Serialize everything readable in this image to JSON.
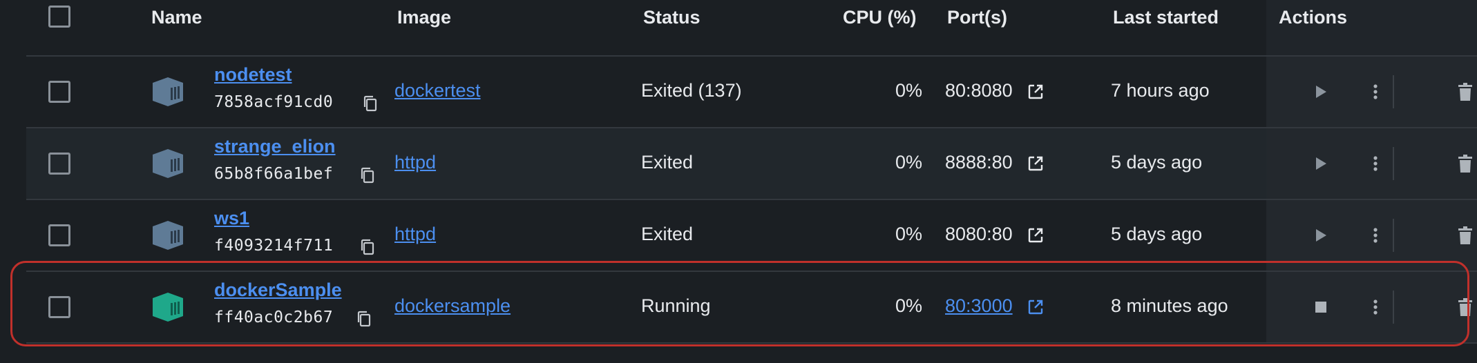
{
  "header": {
    "name": "Name",
    "image": "Image",
    "status": "Status",
    "cpu": "CPU (%)",
    "ports": "Port(s)",
    "last_started": "Last started",
    "actions": "Actions"
  },
  "rows": [
    {
      "name": "nodetest",
      "id": "7858acf91cd0",
      "image": "dockertest",
      "status": "Exited (137)",
      "cpu": "0%",
      "port": "80:8080",
      "last_started": "7 hours ago",
      "running": false
    },
    {
      "name": "strange_elion",
      "id": "65b8f66a1bef",
      "image": "httpd",
      "status": "Exited",
      "cpu": "0%",
      "port": "8888:80",
      "last_started": "5 days ago",
      "running": false
    },
    {
      "name": "ws1",
      "id": "f4093214f711",
      "image": "httpd",
      "status": "Exited",
      "cpu": "0%",
      "port": "8080:80",
      "last_started": "5 days ago",
      "running": false
    },
    {
      "name": "dockerSample",
      "id": "ff40ac0c2b67",
      "image": "dockersample",
      "status": "Running",
      "cpu": "0%",
      "port": "80:3000",
      "last_started": "8 minutes ago",
      "running": true
    }
  ],
  "colors": {
    "background": "#1b1f23",
    "link": "#4c8ff0",
    "container_stopped": "#5f7b96",
    "container_running": "#1fa88a",
    "highlight": "#c0302b"
  },
  "icons": {
    "container": "container-icon",
    "copy": "copy-icon",
    "external_link": "external-link-icon",
    "start": "play-icon",
    "stop": "stop-icon",
    "more": "more-vertical-icon",
    "delete": "trash-icon"
  }
}
